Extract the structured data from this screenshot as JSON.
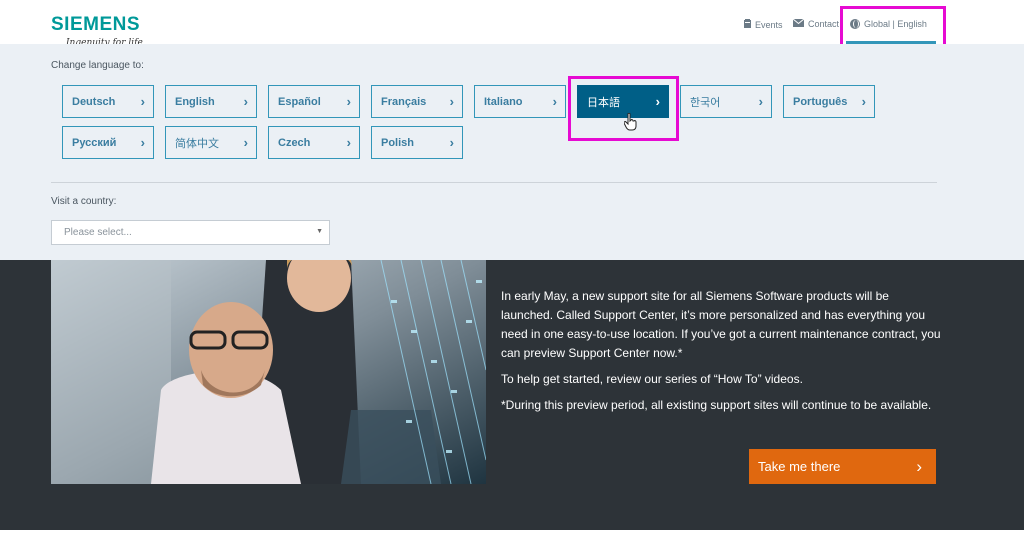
{
  "header": {
    "logo": "SIEMENS",
    "tagline": "Ingenuity for life",
    "nav": {
      "events": "Events",
      "contact": "Contact",
      "language": "Global | English"
    }
  },
  "language_panel": {
    "label": "Change language to:",
    "languages": [
      "Deutsch",
      "English",
      "Español",
      "Français",
      "Italiano",
      "日本語",
      "한국어",
      "Português",
      "Русский",
      "简体中文",
      "Czech",
      "Polish"
    ],
    "active": "日本語",
    "country_label": "Visit a country:",
    "country_placeholder": "Please select..."
  },
  "main": {
    "paragraphs": [
      "In early May, a new support site for all Siemens Software products will be launched. Called Support Center, it’s more personalized and has everything you need in one easy-to-use location. If you’ve got a current maintenance contract, you can preview Support Center now.*",
      "To help get started, review our series of “How To” videos.",
      "*During this preview period, all existing support sites will continue to be available."
    ],
    "cta_label": "Take me there"
  },
  "colors": {
    "brand": "#009999",
    "accent": "#3296b9",
    "active_button": "#005f87",
    "cta": "#e0680f",
    "highlight": "#e60ad2",
    "dark_bg": "#2d3338",
    "panel_bg": "#ebf0f5"
  },
  "icons": [
    "events-icon",
    "contact-icon",
    "globe-icon",
    "chevron-right-icon",
    "caret-down-icon",
    "pointer-cursor-icon"
  ]
}
